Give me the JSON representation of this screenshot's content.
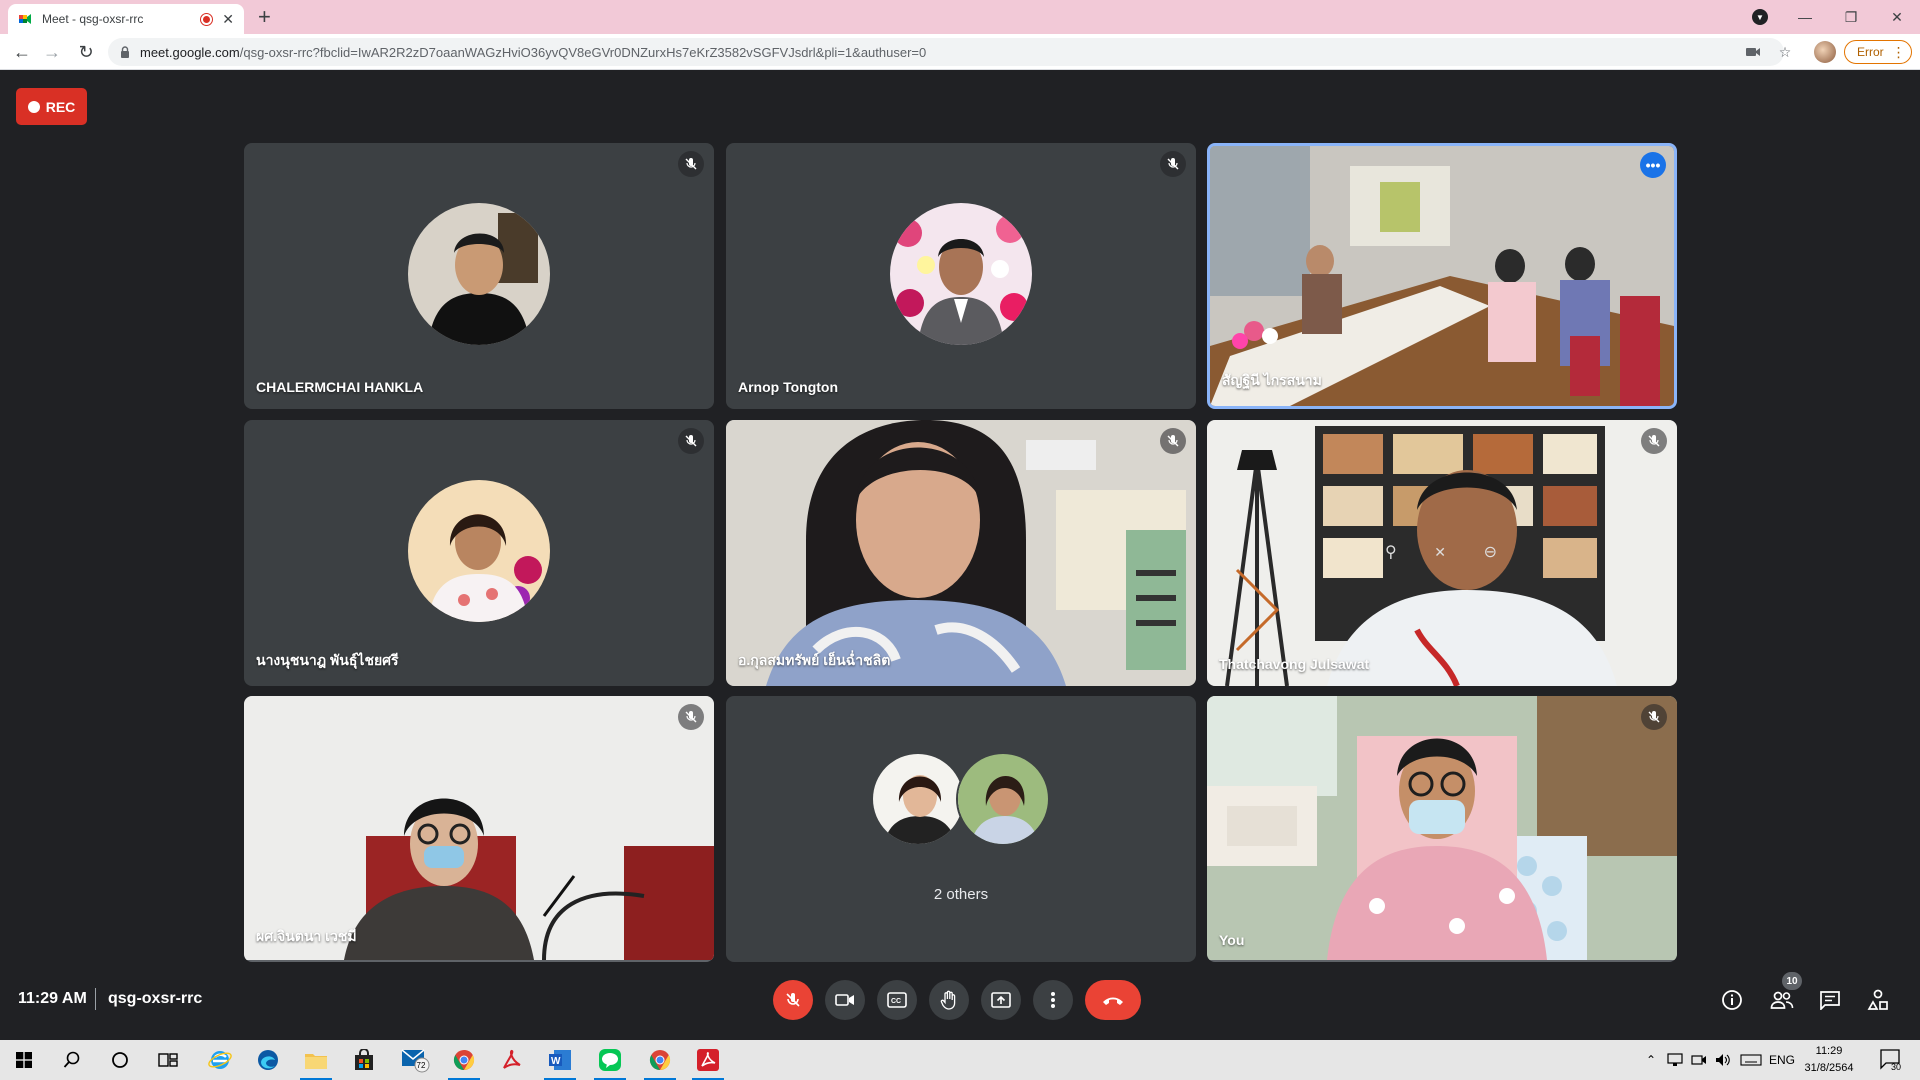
{
  "browser": {
    "tab": {
      "title": "Meet - qsg-oxsr-rrc"
    },
    "new_tab": "+",
    "url": {
      "host": "meet.google.com",
      "path": "/qsg-oxsr-rrc?fbclid=IwAR2R2zD7oaanWAGzHviO36yvQV8eGVr0DNZurxHs7eKrZ3582vSGFVJsdrl&pli=1&authuser=0"
    },
    "error_chip": "Error"
  },
  "meet": {
    "rec_label": "REC",
    "tiles": [
      {
        "name": "CHALERMCHAI HANKLA",
        "kind": "avatar",
        "muted": true
      },
      {
        "name": "Arnop Tongton",
        "kind": "avatar",
        "muted": true
      },
      {
        "name": "สัญฐินี ไกรสนาม",
        "kind": "video",
        "muted": false,
        "active": true
      },
      {
        "name": "นางนุชนาฎ พันธุ์ไชยศรี",
        "kind": "avatar",
        "muted": true
      },
      {
        "name": "อ.กุลสมทรัพย์ เย็นฉ่ำชลิต",
        "kind": "video",
        "muted": true
      },
      {
        "name": "Thatchavong Julsawat",
        "kind": "video",
        "muted": true
      },
      {
        "name": "ผศ.จินตนา เวชมี",
        "kind": "video",
        "muted": true
      },
      {
        "name": "2 others",
        "kind": "others",
        "muted": false
      },
      {
        "name": "You",
        "kind": "video",
        "muted": true
      }
    ],
    "time": "11:29 AM",
    "meeting_code": "qsg-oxsr-rrc",
    "participants_count": "10"
  },
  "taskbar": {
    "lang": "ENG",
    "clock_time": "11:29",
    "clock_date": "31/8/2564",
    "mail_badge": "72",
    "notif_count": "30"
  },
  "colors": {
    "meet_bg": "#202124",
    "tile_bg": "#3c4043",
    "danger": "#ea4335",
    "accent": "#1a73e8",
    "tab_strip": "#f2c9d7"
  }
}
